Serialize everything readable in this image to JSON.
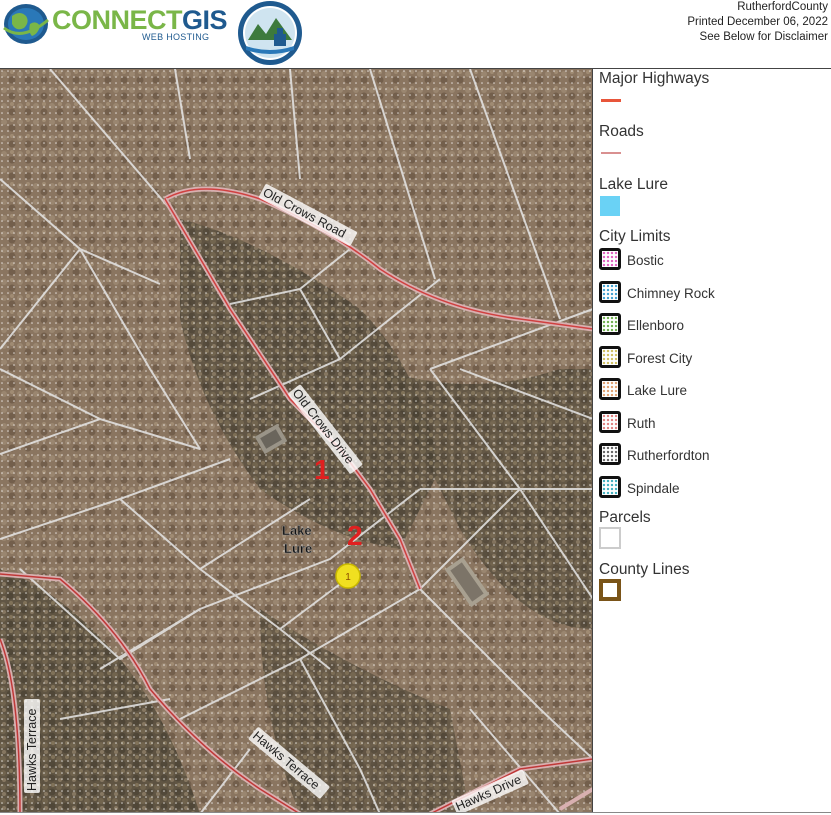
{
  "header": {
    "logo_part1": "CONNECT",
    "logo_part2": "GIS",
    "logo_sub": "WEB HOSTING",
    "county": "RutherfordCounty",
    "printed": "Printed December 06, 2022",
    "disclaimer": "See Below for Disclaimer"
  },
  "map": {
    "road_labels": {
      "old_crows_road": "Old Crows Road",
      "old_crows_drive": "Old Crows Drive",
      "hawks_terrace_1": "Hawks Terrace",
      "hawks_terrace_2": "Hawks Terrace",
      "hawks_drive": "Hawks Drive"
    },
    "area_label": "Lake Lure",
    "marker_1": "1",
    "marker_2": "2",
    "point_marker": "1"
  },
  "legend": {
    "major_highways": {
      "label": "Major Highways",
      "color": "#e8553a"
    },
    "roads": {
      "label": "Roads",
      "color": "#d99090"
    },
    "lake_lure": {
      "label": "Lake Lure",
      "color": "#6ad2f5"
    },
    "city_limits": {
      "label": "City Limits",
      "items": [
        {
          "label": "Bostic",
          "dot": "#e060c0"
        },
        {
          "label": "Chimney Rock",
          "dot": "#40a0d0"
        },
        {
          "label": "Ellenboro",
          "dot": "#70b050"
        },
        {
          "label": "Forest City",
          "dot": "#d0c060"
        },
        {
          "label": "Lake Lure",
          "dot": "#e0a070"
        },
        {
          "label": "Ruth",
          "dot": "#e08080"
        },
        {
          "label": "Rutherfordton",
          "dot": "#666666"
        },
        {
          "label": "Spindale",
          "dot": "#40b0c0"
        }
      ]
    },
    "parcels": {
      "label": "Parcels",
      "color": "#cccccc"
    },
    "county_lines": {
      "label": "County Lines",
      "color": "#7a5418"
    }
  }
}
